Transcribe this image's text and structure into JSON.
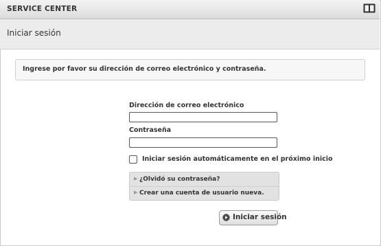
{
  "window": {
    "title": "SERVICE CENTER",
    "manual_icon": "book-icon"
  },
  "page": {
    "title": "Iniciar sesión"
  },
  "notice": {
    "text": "Ingrese por favor su dirección de correo electrónico y contraseña."
  },
  "form": {
    "email_label": "Dirección de correo electrónico",
    "email_value": "",
    "password_label": "Contraseña",
    "password_value": "",
    "auto_login_label": "Iniciar sesión automáticamente en el próximo inicio",
    "auto_login_checked": false,
    "forgot_password_link": "¿Olvidó su contraseña?",
    "create_account_link": "Crear una cuenta de usuario nueva.",
    "submit_label": "Iniciar sesión",
    "submit_icon": "arrow-circle-icon"
  }
}
